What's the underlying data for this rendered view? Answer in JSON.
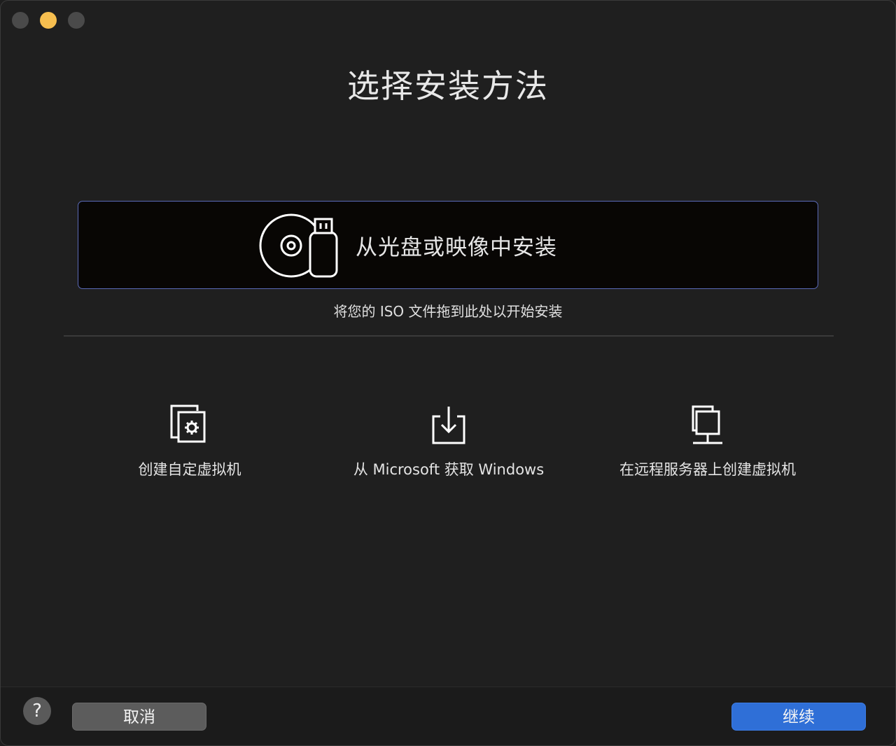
{
  "window": {
    "traffic_lights": [
      "close",
      "minimize",
      "zoom"
    ],
    "colors": {
      "minimize": "#f6be4f",
      "inactive": "#4a4a4a"
    }
  },
  "title": "选择安装方法",
  "primary_option": {
    "label": "从光盘或映像中安装",
    "hint": "将您的 ISO 文件拖到此处以开始安装",
    "icon": "disc-usb-icon",
    "border_color": "#5a6ab8"
  },
  "options": [
    {
      "label": "创建自定虚拟机",
      "icon": "custom-vm-icon"
    },
    {
      "label": "从 Microsoft 获取 Windows",
      "icon": "download-icon"
    },
    {
      "label": "在远程服务器上创建虚拟机",
      "icon": "remote-server-icon"
    }
  ],
  "footer": {
    "help_label": "?",
    "cancel_label": "取消",
    "continue_label": "继续",
    "accent": "#2f6fd7"
  }
}
